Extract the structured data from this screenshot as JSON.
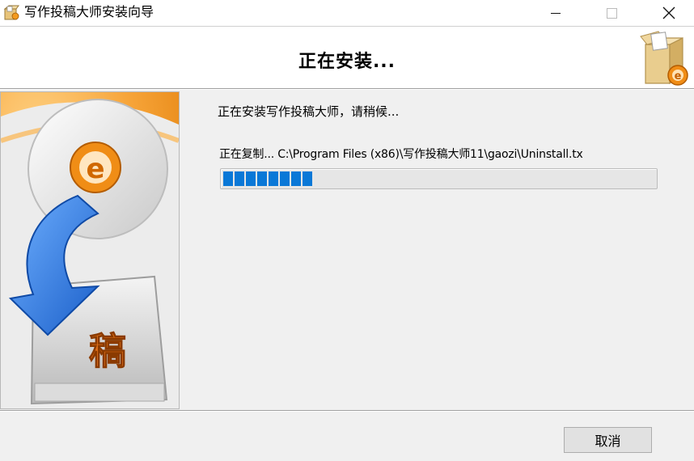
{
  "window": {
    "title": "写作投稿大师安装向导",
    "app_icon": "installer-box-icon",
    "controls": {
      "minimize": "minimize-icon",
      "maximize": "maximize-icon",
      "close": "close-icon"
    }
  },
  "header": {
    "title": "正在安装...",
    "icon": "installer-box-icon"
  },
  "side_image": {
    "icon": "install-disc-arrow-graphic",
    "glyph": "稿",
    "badge_letter": "e"
  },
  "main": {
    "status": "正在安装写作投稿大师，请稍候...",
    "copy_line": "正在复制... C:\\Program Files (x86)\\写作投稿大师11\\gaozi\\Uninstall.tx",
    "progress": {
      "percent": 19,
      "segments_filled": 8,
      "color": "#0a78d7"
    }
  },
  "footer": {
    "cancel_label": "取消"
  }
}
